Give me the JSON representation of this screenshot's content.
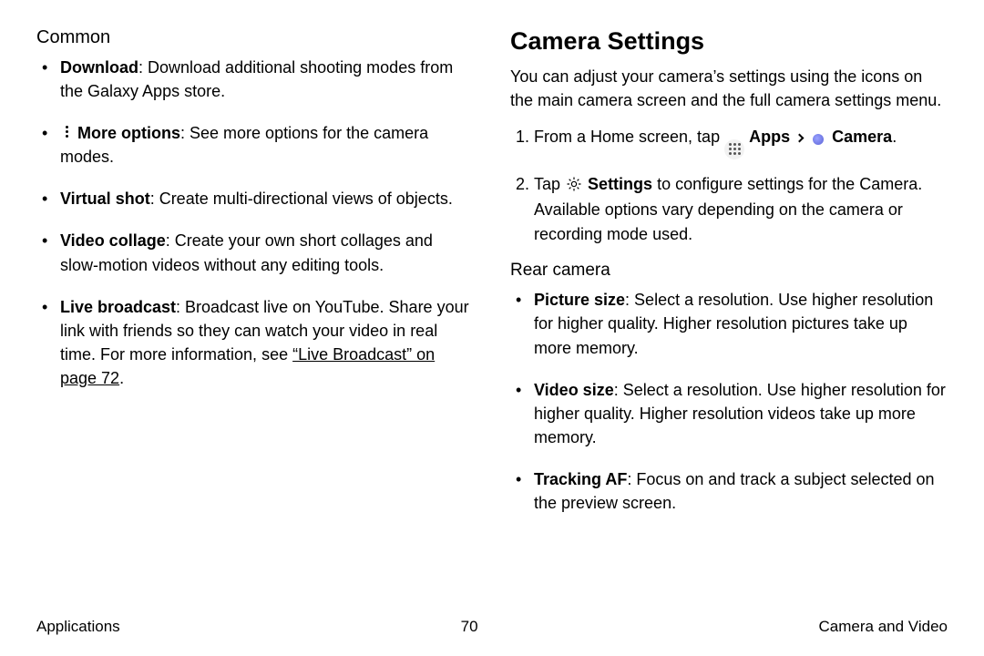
{
  "left": {
    "section_heading": "Common",
    "items": [
      {
        "term": "Download",
        "desc": ": Download additional shooting modes from the Galaxy Apps store."
      },
      {
        "term": "More options",
        "desc": ": See more options for the camera modes.",
        "icon": "more-options"
      },
      {
        "term": "Virtual shot",
        "desc": ": Create multi-directional views of objects."
      },
      {
        "term": "Video collage",
        "desc": ": Create your own short collages and slow-motion videos without any editing tools."
      },
      {
        "term": "Live broadcast",
        "desc": ": Broadcast live on YouTube. Share your link with friends so they can watch your video in real time. For more information, see ",
        "link": "“Live Broadcast” on page 72",
        "tail": "."
      }
    ]
  },
  "right": {
    "heading": "Camera Settings",
    "intro": "You can adjust your camera’s settings using the icons on the main camera screen and the full camera settings menu.",
    "step1_pre": "From a Home screen, tap ",
    "apps_label": "Apps",
    "camera_label": "Camera",
    "step1_post": ".",
    "step2_pre": "Tap ",
    "settings_label": "Settings",
    "step2_post": " to configure settings for the Camera. Available options vary depending on the camera or recording mode used.",
    "sub_heading": "Rear camera",
    "rear_items": [
      {
        "term": "Picture size",
        "desc": ": Select a resolution. Use higher resolution for higher quality. Higher resolution pictures take up more memory."
      },
      {
        "term": "Video size",
        "desc": ": Select a resolution. Use higher resolution for higher quality. Higher resolution videos take up more memory."
      },
      {
        "term": "Tracking AF",
        "desc": ": Focus on and track a subject selected on the preview screen."
      }
    ]
  },
  "footer": {
    "left": "Applications",
    "center": "70",
    "right": "Camera and Video"
  }
}
